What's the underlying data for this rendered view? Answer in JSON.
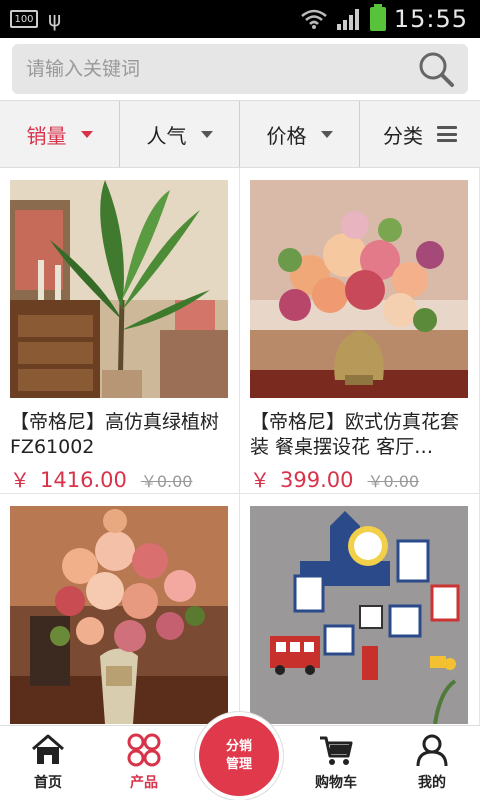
{
  "status_bar": {
    "battery_small": "100",
    "time": "15:55"
  },
  "search": {
    "placeholder": "请输入关键词"
  },
  "filters": [
    {
      "label": "销量"
    },
    {
      "label": "人气"
    },
    {
      "label": "价格"
    },
    {
      "label": "分类"
    }
  ],
  "products": [
    {
      "title": "【帝格尼】高仿真绿植树FZ61002",
      "currency": "￥",
      "price": "1416.00",
      "old_price": "￥0.00"
    },
    {
      "title": "【帝格尼】欧式仿真花套装 餐桌摆设花 客厅…",
      "currency": "￥",
      "price": "399.00",
      "old_price": "￥0.00"
    },
    {
      "title": "",
      "currency": "",
      "price": "",
      "old_price": ""
    },
    {
      "title": "",
      "currency": "",
      "price": "",
      "old_price": ""
    }
  ],
  "bottom_nav": {
    "home": "首页",
    "products": "产品",
    "center_line1": "分销",
    "center_line2": "管理",
    "cart": "购物车",
    "mine": "我的"
  },
  "colors": {
    "accent": "#d8334a",
    "status_bar": "#000000",
    "battery": "#58c23b"
  }
}
